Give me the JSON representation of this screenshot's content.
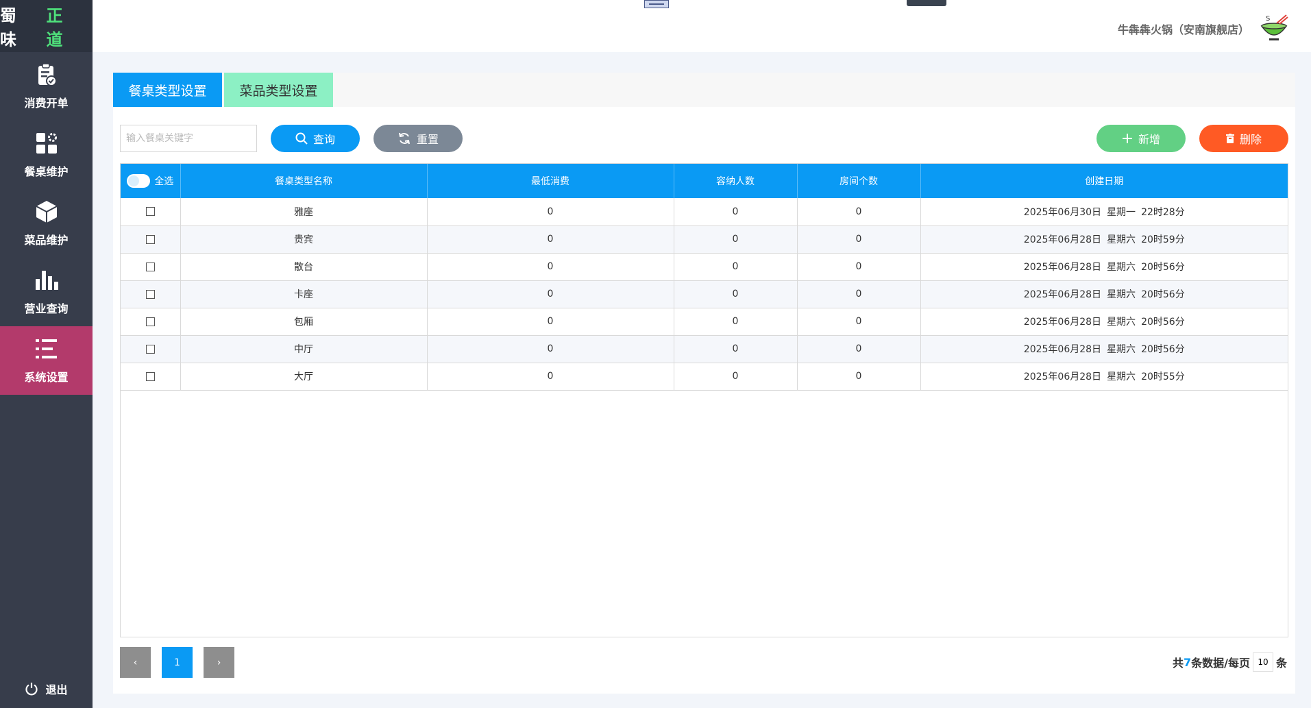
{
  "brand": {
    "part1": "蜀 味 ",
    "part2": "正 道"
  },
  "sidebar": {
    "items": [
      {
        "label": "消费开单",
        "icon": "clipboard-check-icon"
      },
      {
        "label": "餐桌维护",
        "icon": "grid-apps-icon"
      },
      {
        "label": "菜品维护",
        "icon": "cube-icon"
      },
      {
        "label": "营业查询",
        "icon": "bar-chart-icon"
      },
      {
        "label": "系统设置",
        "icon": "list-settings-icon",
        "active": true
      }
    ],
    "logout_label": "退出"
  },
  "header": {
    "shop_name": "牛犇犇火锅（安南旗舰店）"
  },
  "tabs": [
    {
      "label": "餐桌类型设置",
      "active": true
    },
    {
      "label": "菜品类型设置",
      "active": false
    }
  ],
  "toolbar": {
    "search_placeholder": "输入餐桌关键字",
    "search_label": "查询",
    "reset_label": "重置",
    "add_label": "新增",
    "delete_label": "删除"
  },
  "table": {
    "select_all_label": "全选",
    "columns": [
      "餐桌类型名称",
      "最低消费",
      "容纳人数",
      "房间个数",
      "创建日期"
    ],
    "rows": [
      {
        "name": "雅座",
        "min": "0",
        "cap": "0",
        "rooms": "0",
        "date": "2025年06月30日",
        "weekday": "星期一",
        "time": "22时28分"
      },
      {
        "name": "贵宾",
        "min": "0",
        "cap": "0",
        "rooms": "0",
        "date": "2025年06月28日",
        "weekday": "星期六",
        "time": "20时59分"
      },
      {
        "name": "散台",
        "min": "0",
        "cap": "0",
        "rooms": "0",
        "date": "2025年06月28日",
        "weekday": "星期六",
        "time": "20时56分"
      },
      {
        "name": "卡座",
        "min": "0",
        "cap": "0",
        "rooms": "0",
        "date": "2025年06月28日",
        "weekday": "星期六",
        "time": "20时56分"
      },
      {
        "name": "包厢",
        "min": "0",
        "cap": "0",
        "rooms": "0",
        "date": "2025年06月28日",
        "weekday": "星期六",
        "time": "20时56分"
      },
      {
        "name": "中厅",
        "min": "0",
        "cap": "0",
        "rooms": "0",
        "date": "2025年06月28日",
        "weekday": "星期六",
        "time": "20时56分"
      },
      {
        "name": "大厅",
        "min": "0",
        "cap": "0",
        "rooms": "0",
        "date": "2025年06月28日",
        "weekday": "星期六",
        "time": "20时55分"
      }
    ]
  },
  "pagination": {
    "prev": "‹",
    "current": "1",
    "next": "›",
    "info_prefix": "共",
    "total": "7",
    "info_mid": "条数据/每页",
    "page_size": "10",
    "info_suffix": "条"
  },
  "colors": {
    "primary": "#0a9af4",
    "active_nav": "#b33a6b",
    "add": "#62d084",
    "delete": "#ff5a24",
    "sidebar": "#373d4b"
  }
}
